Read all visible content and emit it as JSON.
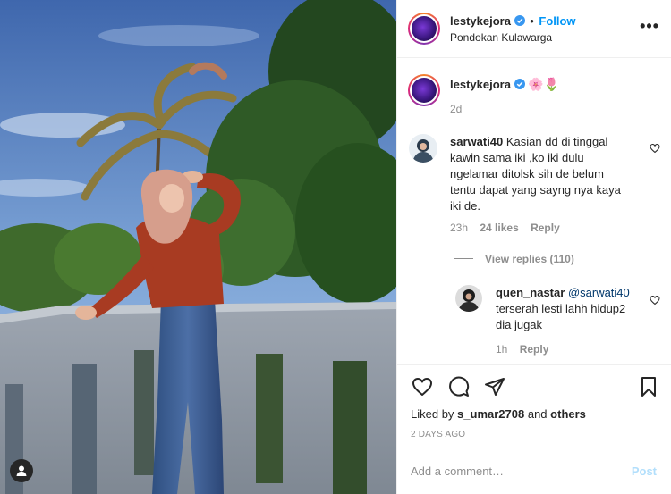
{
  "post": {
    "author": {
      "username": "lestykejora",
      "follow_label": "Follow",
      "location": "Pondokan Kulawarga"
    },
    "caption": {
      "username": "lestykejora",
      "emoji": "🌸🌷",
      "age": "2d"
    },
    "comments": [
      {
        "username": "sarwati40",
        "lines": [
          "Kasian dd di tinggal",
          "kawin sama iki ,ko iki dulu",
          "ngelamar ditolsk sih de belum",
          "tentu dapat yang sayng nya kaya",
          "iki de."
        ],
        "age": "23h",
        "likes": "24 likes",
        "reply_label": "Reply",
        "view_replies": "View replies (110)"
      },
      {
        "username": "quen_nastar",
        "mention": "@sarwati40",
        "lines": [
          "terserah lesti lahh hidup2",
          "dia jugak"
        ],
        "age": "1h",
        "reply_label": "Reply"
      }
    ],
    "liked_by": {
      "prefix": "Liked by",
      "user": "s_umar2708",
      "and": "and",
      "others": "others"
    },
    "date": "2 DAYS AGO",
    "add_comment": {
      "placeholder": "Add a comment…",
      "post_label": "Post"
    }
  },
  "icons": {
    "like": "heart-icon",
    "comment": "comment-icon",
    "share": "paper-plane-icon",
    "save": "bookmark-icon",
    "more": "more-icon",
    "verified": "verified-badge-icon",
    "user_tag": "user-tag-icon"
  },
  "colors": {
    "follow_blue": "#0095f6",
    "post_disabled": "#b2dffc",
    "meta_gray": "#8e8e8e",
    "mention": "#00376b"
  }
}
